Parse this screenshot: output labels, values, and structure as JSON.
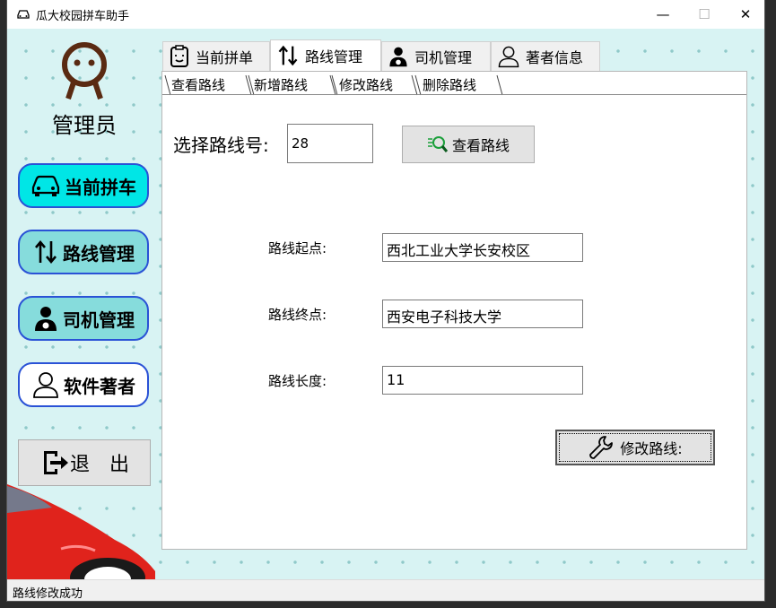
{
  "window": {
    "title": "瓜大校园拼车助手",
    "minimize": "—",
    "maximize": "☐",
    "close": "✕"
  },
  "sidebar": {
    "role": "管理员",
    "buttons": [
      {
        "label": "当前拼车",
        "icon": "car-icon"
      },
      {
        "label": "路线管理",
        "icon": "route-arrows-icon"
      },
      {
        "label": "司机管理",
        "icon": "driver-icon"
      },
      {
        "label": "软件著者",
        "icon": "user-icon"
      }
    ],
    "exit_label": "退　出"
  },
  "tabs": [
    {
      "label": "当前拼单",
      "icon": "clipboard-icon",
      "active": false
    },
    {
      "label": "路线管理",
      "icon": "route-arrows-icon",
      "active": true
    },
    {
      "label": "司机管理",
      "icon": "driver-icon",
      "active": false
    },
    {
      "label": "著者信息",
      "icon": "user-icon",
      "active": false
    }
  ],
  "subtabs": [
    {
      "label": "查看路线",
      "active": false
    },
    {
      "label": "新增路线",
      "active": false
    },
    {
      "label": "修改路线",
      "active": true
    },
    {
      "label": "删除路线",
      "active": false
    }
  ],
  "form": {
    "route_select_label": "选择路线号:",
    "route_number": "28",
    "view_button": "查看路线",
    "start_label": "路线起点:",
    "start_value": "西北工业大学长安校区",
    "end_label": "路线终点:",
    "end_value": "西安电子科技大学",
    "length_label": "路线长度:",
    "length_value": "11",
    "modify_button": "修改路线:"
  },
  "statusbar": {
    "message": "路线修改成功"
  },
  "colors": {
    "background": "#d8f3f3",
    "active_nav": "#00e6e6",
    "nav": "#86dcdc",
    "nav_border": "#2a52d6"
  }
}
